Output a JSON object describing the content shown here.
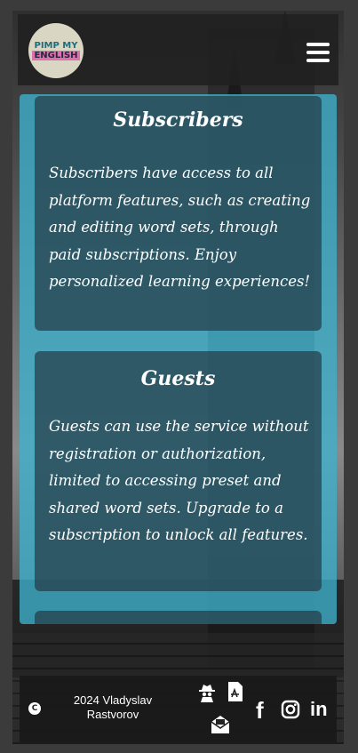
{
  "header": {
    "logo": {
      "line1": "PIMP MY",
      "line2": "ENGLISH",
      "line3": ""
    },
    "menu_icon": "hamburger-menu-icon"
  },
  "cards": [
    {
      "title": "Subscribers",
      "text": "Subscribers have access to all platform features, such as creating and editing word sets, through paid subscriptions. Enjoy personalized learning experiences!"
    },
    {
      "title": "Guests",
      "text": "Guests can use the service without registration or authorization, limited to accessing preset and shared word sets. Upgrade to a subscription to unlock all features."
    }
  ],
  "footer": {
    "copyright_symbol": "C",
    "copyright_line1": "2024 Vladyslav",
    "copyright_line2": "Rastvorov",
    "icons": [
      "detective-icon",
      "pdf-file-icon",
      "mail-icon"
    ],
    "social": {
      "facebook": "f",
      "instagram": "instagram-icon",
      "linkedin": "in"
    }
  },
  "colors": {
    "panel": "#3db2ce",
    "card": "#263c46",
    "header": "#202020",
    "footer": "#191919"
  }
}
